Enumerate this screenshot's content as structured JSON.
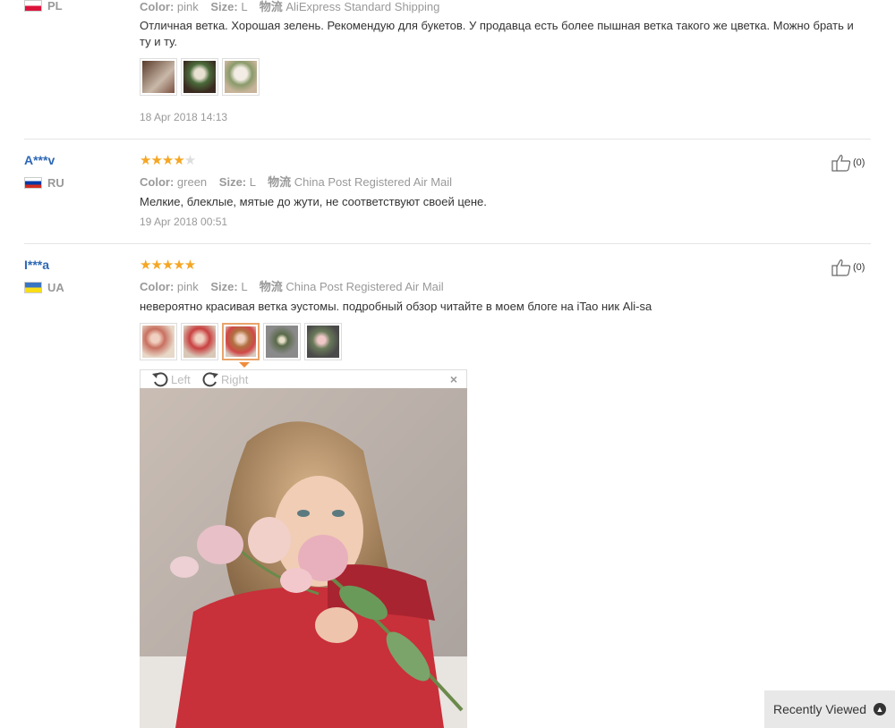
{
  "reviews": [
    {
      "country": "PL",
      "color_label": "Color:",
      "color": "pink",
      "size_label": "Size:",
      "size": "L",
      "ship_prefix": "物流",
      "shipping": "AliExpress Standard Shipping",
      "text": "Отличная ветка. Хорошая зелень. Рекомендую для букетов. У продавца есть более пышная ветка такого же цветка. Можно брать и ту и ту.",
      "date": "18 Apr 2018 14:13"
    },
    {
      "user": "A***v",
      "country": "RU",
      "rating": 4,
      "color_label": "Color:",
      "color": "green",
      "size_label": "Size:",
      "size": "L",
      "ship_prefix": "物流",
      "shipping": "China Post Registered Air Mail",
      "text": "Мелкие, блеклые, мятые до жути, не соответствуют своей цене.",
      "date": "19 Apr 2018 00:51",
      "likes": "(0)"
    },
    {
      "user": "I***a",
      "country": "UA",
      "rating": 5,
      "color_label": "Color:",
      "color": "pink",
      "size_label": "Size:",
      "size": "L",
      "ship_prefix": "物流",
      "shipping": "China Post Registered Air Mail",
      "text": "невероятно красивая ветка эустомы. подробный обзор читайте в моем блоге на iTao ник Ali-sa",
      "likes": "(0)"
    }
  ],
  "viewer": {
    "rotate_left": "Left",
    "rotate_right": "Right",
    "close": "×"
  },
  "recently_viewed": "Recently Viewed",
  "icons": {
    "like": "thumbs-up-icon",
    "close": "close-icon",
    "rotate_left": "rotate-left-icon",
    "rotate_right": "rotate-right-icon",
    "expand": "chevron-up-icon"
  },
  "colors": {
    "star": "#f5a623",
    "username": "#2d67b5",
    "active_thumb": "#e8a46a"
  }
}
